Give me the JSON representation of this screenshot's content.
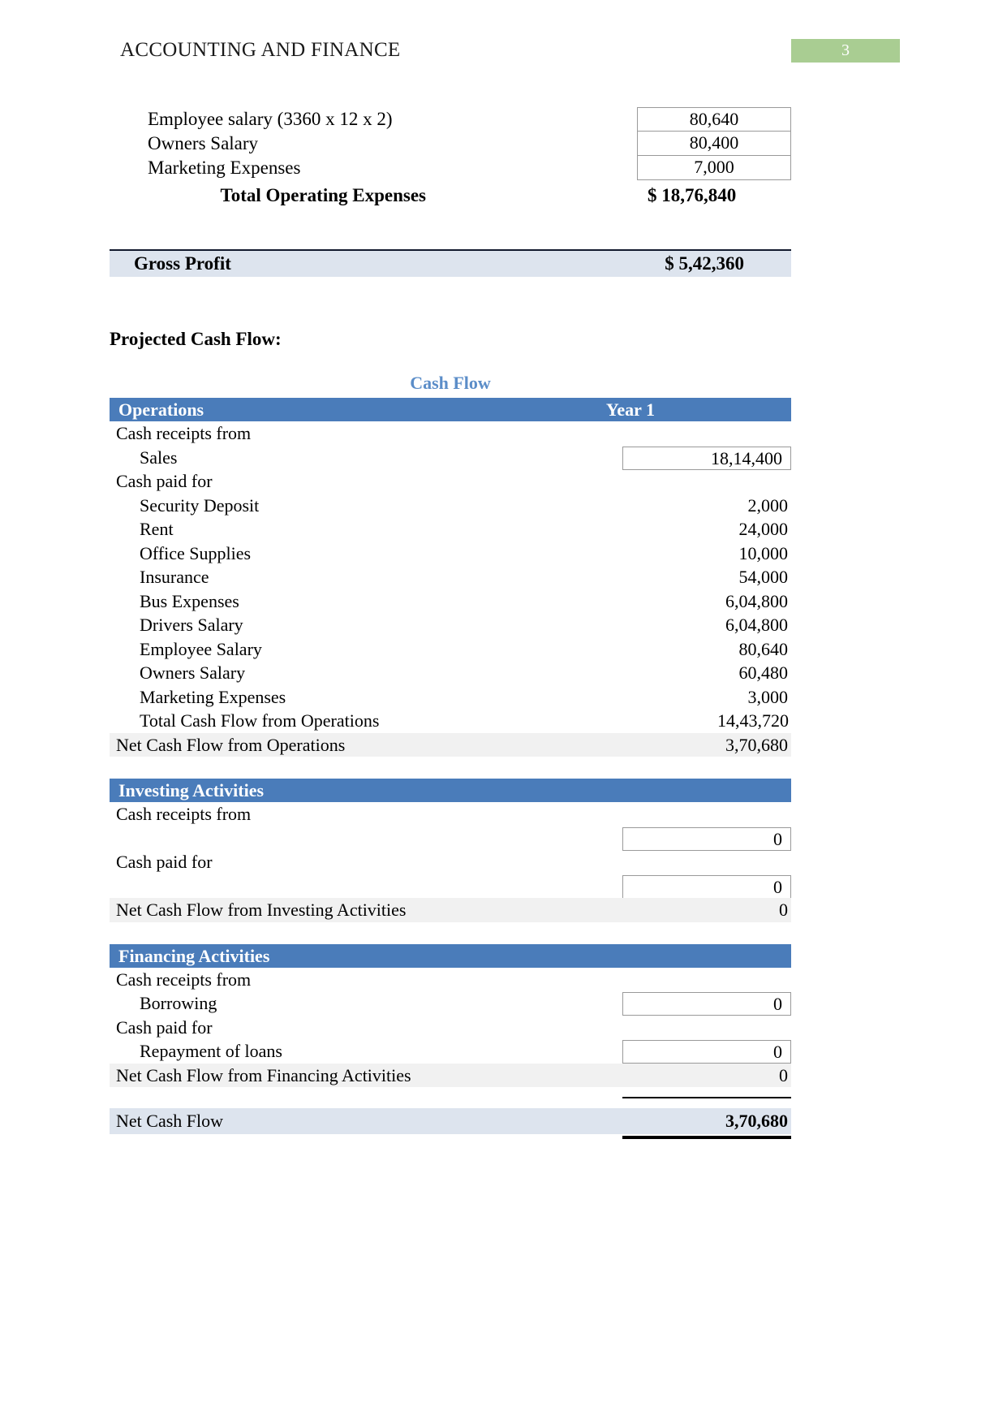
{
  "header": {
    "title": "ACCOUNTING AND FINANCE",
    "page_number": "3",
    "badge_color": "#a9cd92"
  },
  "expenses": {
    "rows": [
      {
        "label": "Employee salary (3360 x 12 x 2)",
        "value": "80,640"
      },
      {
        "label": "Owners Salary",
        "value": "80,400"
      },
      {
        "label": "Marketing Expenses",
        "value": "7,000"
      }
    ],
    "total_label": "Total Operating Expenses",
    "total_value": "$ 18,76,840"
  },
  "gross_profit": {
    "label": "Gross Profit",
    "value": "$   5,42,360"
  },
  "section_heading": "Projected Cash Flow:",
  "cash_flow": {
    "title": "Cash Flow",
    "operations": {
      "header_label": "Operations",
      "header_year": "Year 1",
      "receipts_label": "Cash receipts from",
      "sales_label": "Sales",
      "sales_value": "18,14,400",
      "paid_label": "Cash paid for",
      "items": [
        {
          "label": "Security Deposit",
          "value": "2,000"
        },
        {
          "label": "Rent",
          "value": "24,000"
        },
        {
          "label": "Office Supplies",
          "value": "10,000"
        },
        {
          "label": "Insurance",
          "value": "54,000"
        },
        {
          "label": "Bus Expenses",
          "value": "6,04,800"
        },
        {
          "label": "Drivers Salary",
          "value": "6,04,800"
        },
        {
          "label": "Employee Salary",
          "value": "80,640"
        },
        {
          "label": "Owners Salary",
          "value": "60,480"
        },
        {
          "label": "Marketing Expenses",
          "value": "3,000"
        }
      ],
      "total_label": "Total Cash Flow from Operations",
      "total_value": "14,43,720",
      "net_label": "Net Cash Flow from Operations",
      "net_value": "3,70,680"
    },
    "investing": {
      "header_label": "Investing Activities",
      "receipts_label": "Cash receipts from",
      "receipts_value": "0",
      "paid_label": "Cash paid for",
      "paid_value": "0",
      "net_label": "Net Cash Flow from Investing Activities",
      "net_value": "0"
    },
    "financing": {
      "header_label": "Financing Activities",
      "receipts_label": "Cash receipts from",
      "borrowing_label": "Borrowing",
      "borrowing_value": "0",
      "paid_label": "Cash paid for",
      "repayment_label": "Repayment of loans",
      "repayment_value": "0",
      "net_label": "Net Cash Flow from Financing Activities",
      "net_value": "0"
    },
    "net_total": {
      "label": "Net Cash Flow",
      "value": "3,70,680"
    }
  },
  "colors": {
    "header_bar": "#4a7cba",
    "title_blue": "#5b8dc8",
    "shade_gray": "#f1f1f1",
    "shade_blue": "#dde4ee"
  }
}
